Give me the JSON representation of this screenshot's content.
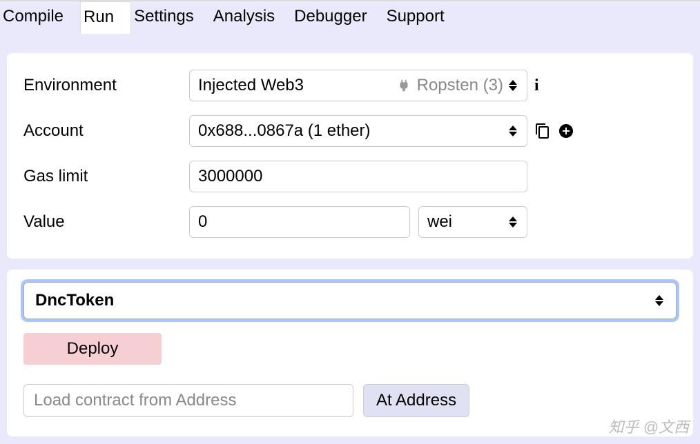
{
  "tabs": {
    "compile": "Compile",
    "run": "Run",
    "settings": "Settings",
    "analysis": "Analysis",
    "debugger": "Debugger",
    "support": "Support",
    "active": "run"
  },
  "form": {
    "environment": {
      "label": "Environment",
      "value": "Injected Web3",
      "network": "Ropsten (3)"
    },
    "account": {
      "label": "Account",
      "value": "0x688...0867a (1 ether)"
    },
    "gas": {
      "label": "Gas limit",
      "value": "3000000"
    },
    "value": {
      "label": "Value",
      "amount": "0",
      "unit": "wei"
    }
  },
  "deploy": {
    "contract": "DncToken",
    "deploy_label": "Deploy",
    "address_placeholder": "Load contract from Address",
    "at_address_label": "At Address"
  },
  "watermark": "知乎 @文西"
}
